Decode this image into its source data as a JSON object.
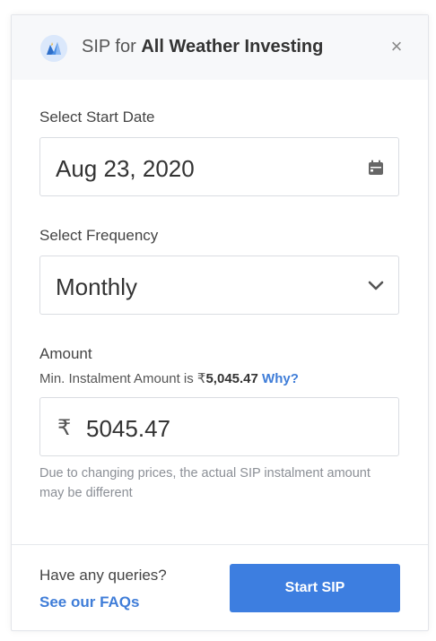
{
  "modal": {
    "title_prefix": "SIP for",
    "title_name": "All Weather Investing",
    "close_glyph": "×"
  },
  "start_date": {
    "label": "Select Start Date",
    "value": "Aug 23, 2020",
    "icon": "calendar-icon"
  },
  "frequency": {
    "label": "Select Frequency",
    "value": "Monthly",
    "icon": "chevron-down-icon"
  },
  "amount": {
    "label": "Amount",
    "hint_prefix": "Min. Instalment Amount is",
    "hint_currency": "₹",
    "hint_value": "5,045.47",
    "why_link": "Why?",
    "currency_symbol": "₹",
    "value": "5045.47",
    "note": "Due to changing prices, the actual SIP instalment amount may be different"
  },
  "footer": {
    "queries": "Have any queries?",
    "faq_link": "See our FAQs",
    "start_button": "Start SIP"
  },
  "colors": {
    "accent": "#3d7ee0",
    "link": "#3f7dd8"
  }
}
